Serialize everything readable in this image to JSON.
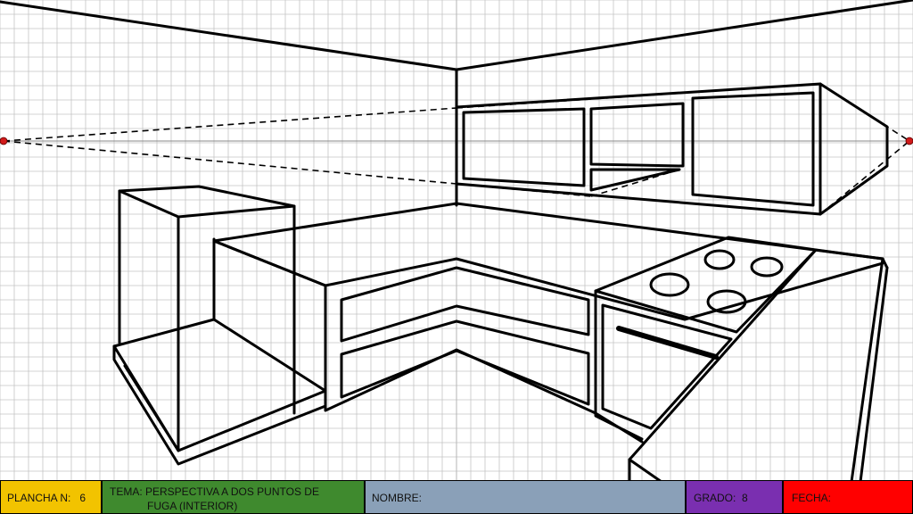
{
  "colors": {
    "grid": "#c4c4c4",
    "horizon": "#8a8a8a",
    "ink": "#000000",
    "vanishing_point": "#d11a1a",
    "plancha": "#f2c300",
    "tema": "#3f8a2e",
    "nombre": "#8aa0b8",
    "grado": "#7a2fb0",
    "fecha": "#ff0000"
  },
  "footer": {
    "plancha_label": "PLANCHA N:",
    "plancha_value": "6",
    "tema_label_line1": "TEMA: PERSPECTIVA A DOS PUNTOS DE",
    "tema_label_line2": "FUGA (INTERIOR)",
    "nombre_label": "NOMBRE:",
    "grado_label": "GRADO:",
    "grado_value": "8",
    "fecha_label": "FECHA:"
  }
}
